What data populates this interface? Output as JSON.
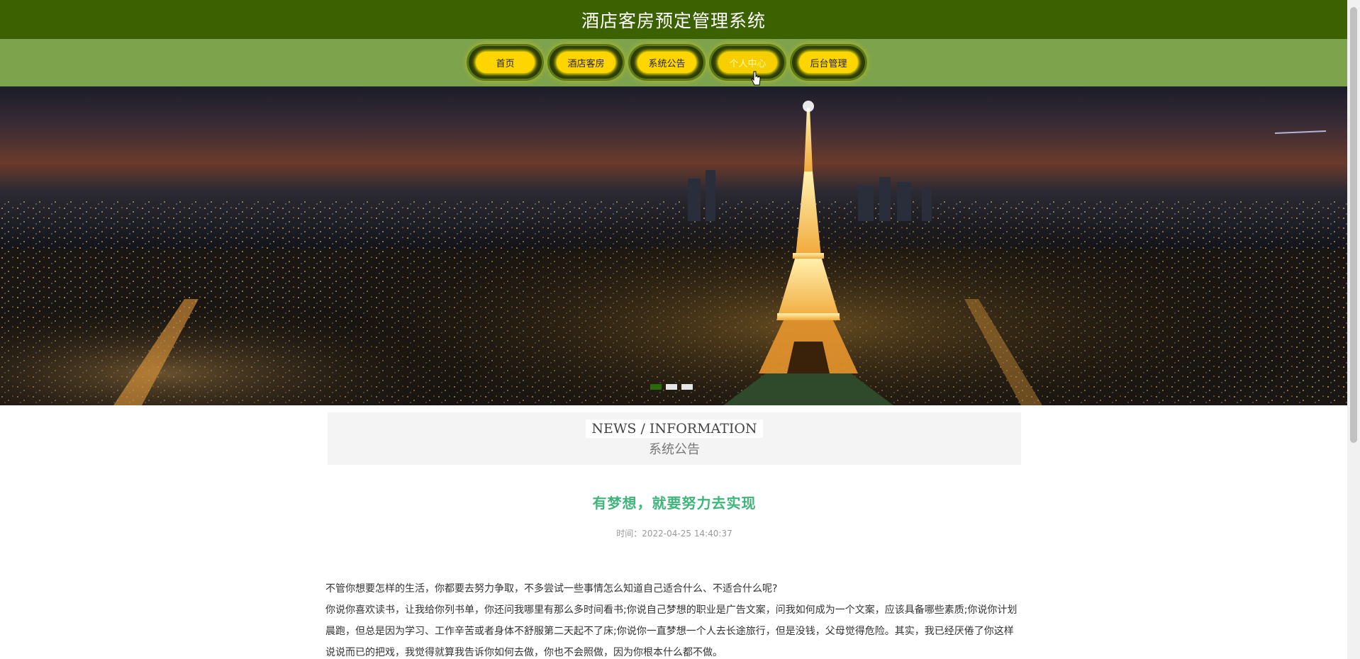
{
  "header": {
    "title": "酒店客房预定管理系统"
  },
  "nav": {
    "items": [
      {
        "label": "首页"
      },
      {
        "label": "酒店客房"
      },
      {
        "label": "系统公告"
      },
      {
        "label": "个人中心"
      },
      {
        "label": "后台管理"
      }
    ],
    "active_index": 3
  },
  "banner": {
    "slide_count": 3,
    "active_slide": 1
  },
  "news": {
    "en_title": "NEWS / INFORMATION",
    "cn_title": "系统公告"
  },
  "article": {
    "title": "有梦想，就要努力去实现",
    "time": "时间：2022-04-25 14:40:37",
    "paragraphs": [
      "不管你想要怎样的生活，你都要去努力争取，不多尝试一些事情怎么知道自己适合什么、不适合什么呢?",
      "你说你喜欢读书，让我给你列书单，你还问我哪里有那么多时间看书;你说自己梦想的职业是广告文案，问我如何成为一个文案，应该具备哪些素质;你说你计划晨跑，但总是因为学习、工作辛苦或者身体不舒服第二天起不了床;你说你一直梦想一个人去长途旅行，但是没钱，父母觉得危险。其实，我已经厌倦了你这样说说而已的把戏，我觉得就算我告诉你如何去做，你也不会照做，因为你根本什么都不做。"
    ]
  },
  "colors": {
    "header_bg": "#3c6100",
    "nav_bg": "#7ea34d",
    "nav_pill": "#ffd500",
    "article_title": "#3fb57a"
  }
}
